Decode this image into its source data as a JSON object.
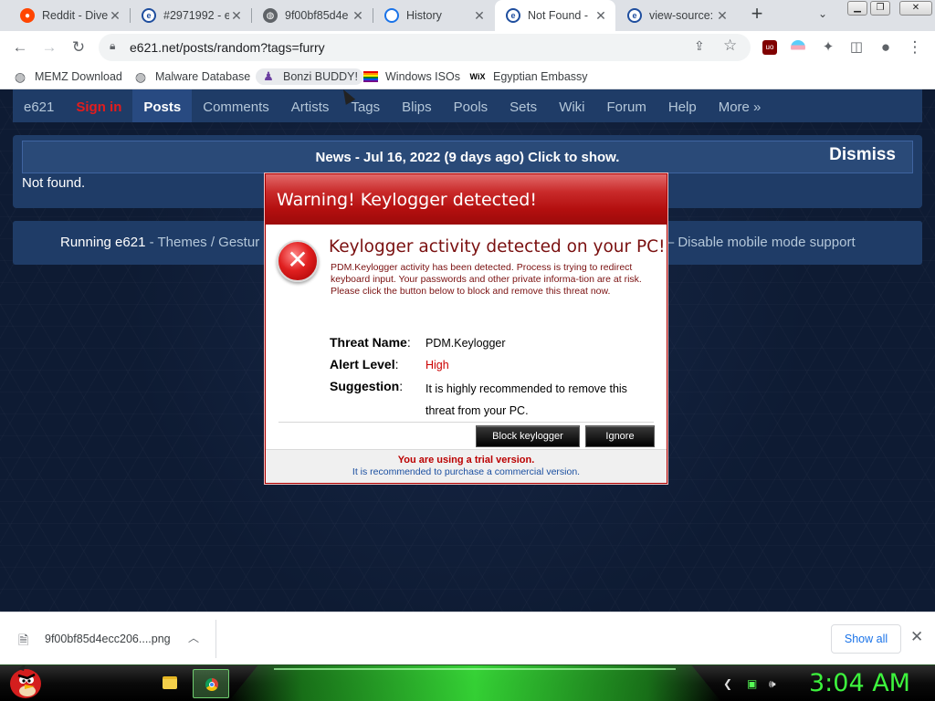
{
  "tabs": [
    {
      "title": "Reddit - Dive",
      "favicon": "reddit-icon"
    },
    {
      "title": "#2971992 - e",
      "favicon": "e621-icon"
    },
    {
      "title": "9f00bf85d4e",
      "favicon": "globe-icon"
    },
    {
      "title": "History",
      "favicon": "history-icon"
    },
    {
      "title": "Not Found -",
      "favicon": "e621-icon",
      "active": true
    },
    {
      "title": "view-source:",
      "favicon": "e621-icon"
    }
  ],
  "toolbar": {
    "url": "e621.net/posts/random?tags=furry"
  },
  "bookmarks": [
    {
      "label": "MEMZ Download",
      "icon": "globe-icon"
    },
    {
      "label": "Malware Database",
      "icon": "globe-icon"
    },
    {
      "label": "Bonzi BUDDY!",
      "icon": "bonzi-icon"
    },
    {
      "label": "Windows ISOs",
      "icon": "rainbow-flag-icon"
    },
    {
      "label": "Egyptian Embassy",
      "icon": "wix-icon"
    }
  ],
  "bookmark_wix_glyph": "WiX",
  "site_nav": {
    "site": "e621",
    "signin": "Sign in",
    "items": [
      "Posts",
      "Comments",
      "Artists",
      "Tags",
      "Blips",
      "Pools",
      "Sets",
      "Wiki",
      "Forum",
      "Help",
      "More »"
    ]
  },
  "news": {
    "text": "News - Jul 16, 2022 (9 days ago) Click to show.",
    "dismiss": "Dismiss"
  },
  "not_found": "Not found.",
  "footer": {
    "running": "Running e621",
    "links_left": " - Themes / Gestur",
    "links_right": "ts – Disable mobile mode support"
  },
  "dialog": {
    "title": "Warning! Keylogger detected!",
    "heading": "Keylogger activity detected on your PC!",
    "description": "PDM.Keylogger activity has been detected. Process is trying to redirect keyboard input. Your passwords and other private informa-tion are at risk. Please click the button below to block and remove this threat now.",
    "threat_label": "Threat Name",
    "threat_value": "PDM.Keylogger",
    "alert_label": "Alert Level",
    "alert_value": "High",
    "suggestion_label": "Suggestion",
    "suggestion_value": "It is highly recommended to remove this threat from your PC.",
    "block_button": "Block keylogger",
    "ignore_button": "Ignore",
    "trial": "You are using a trial version.",
    "purchase": "It is recommended to purchase a commercial version."
  },
  "download": {
    "filename": "9f00bf85d4ecc206....png",
    "show_all": "Show all"
  },
  "taskbar": {
    "clock": "3:04 AM"
  },
  "colors": {
    "dialog_red": "#b30f0f",
    "site_nav_bg": "#1f3c67",
    "clock_green": "#3df33d",
    "signin_red": "#e41c1c"
  }
}
